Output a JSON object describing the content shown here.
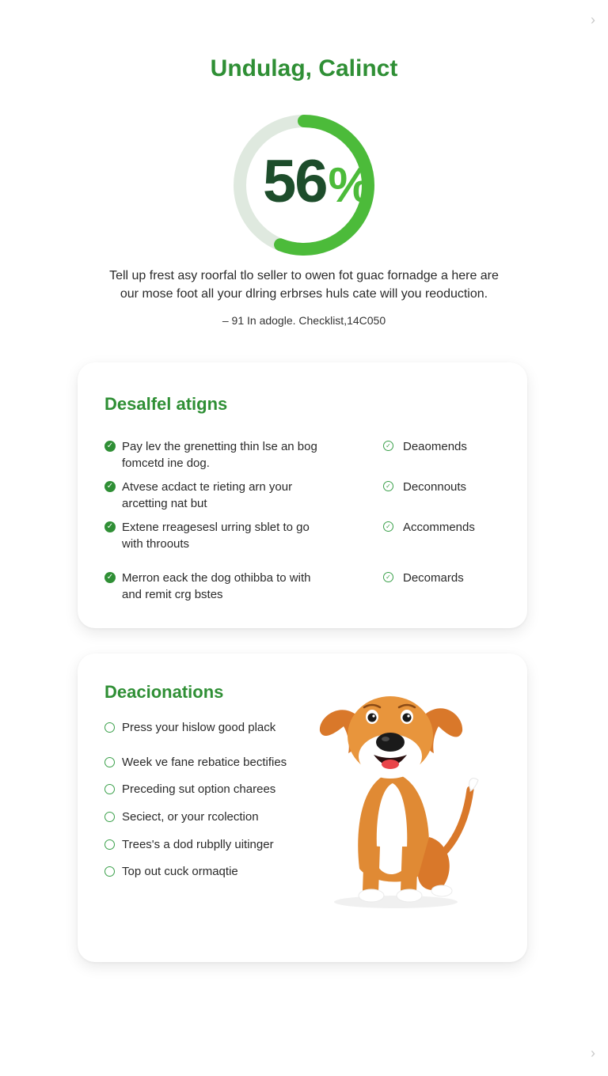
{
  "header": {
    "title": "Undulag, Calinct",
    "progress_value": "56",
    "progress_percent_sign": "%",
    "progress_fraction": 0.56,
    "intro_lines": [
      "Tell up frest asy roorfal tlo seller to owen fot guac fornadge a here are",
      "our mose foot all your dlring erbrses huls cate will you reoduction."
    ],
    "byline": "– 91 In adogle. Checklist,14C050"
  },
  "checklist": {
    "title": "Desalfel atigns",
    "rows": [
      {
        "left": [
          "Pay lev the grenetting thin lse an bog",
          "fomcetd ine dog."
        ],
        "right": "Deaomends"
      },
      {
        "left": [
          "Atvese acdact te rieting arn your",
          "arcetting nat but"
        ],
        "right": "Deconnouts"
      },
      {
        "left": [
          "Extene rreagesesl urring sblet to go",
          "with throouts"
        ],
        "right": "Accommends"
      },
      {
        "left": [
          "Merron eack the dog othibba to with",
          "and remit crg bstes"
        ],
        "right": "Decomards"
      }
    ]
  },
  "options": {
    "title": "Deacionations",
    "items": [
      "Press your hislow good plack",
      "Week ve fane rebatice bectifies",
      "Preceding sut option charees",
      "Seciect, or your rcolection",
      "Trees's a dod rubplly uitinger",
      "Top out cuck ormaqtie"
    ]
  },
  "colors": {
    "accent": "#2f8f35",
    "ring_fill": "#4cbb3a",
    "ring_track": "#dfe9df",
    "value_dark": "#1d4d2b",
    "dog_orange": "#e08a34"
  },
  "icons": {
    "nav_top": "chevron-right-icon",
    "nav_bottom": "chevron-right-icon",
    "check_filled": "check-circle-filled-icon",
    "check_outline": "check-circle-outline-icon",
    "radio": "radio-empty-icon",
    "illustration": "dog-illustration"
  }
}
